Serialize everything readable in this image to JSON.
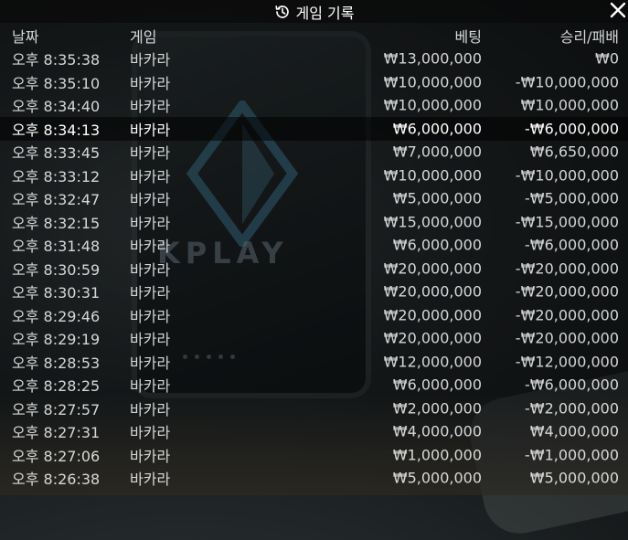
{
  "title": "게임 기록",
  "columns": {
    "date": "날짜",
    "game": "게임",
    "bet": "베팅",
    "result": "승리/패배"
  },
  "background_brand": "KPLAY",
  "highlight_row_index": 3,
  "rows": [
    {
      "date": "오후 8:35:38",
      "game": "바카라",
      "bet": "₩13,000,000",
      "result": "₩0"
    },
    {
      "date": "오후 8:35:10",
      "game": "바카라",
      "bet": "₩10,000,000",
      "result": "-₩10,000,000"
    },
    {
      "date": "오후 8:34:40",
      "game": "바카라",
      "bet": "₩10,000,000",
      "result": "₩10,000,000"
    },
    {
      "date": "오후 8:34:13",
      "game": "바카라",
      "bet": "₩6,000,000",
      "result": "-₩6,000,000"
    },
    {
      "date": "오후 8:33:45",
      "game": "바카라",
      "bet": "₩7,000,000",
      "result": "₩6,650,000"
    },
    {
      "date": "오후 8:33:12",
      "game": "바카라",
      "bet": "₩10,000,000",
      "result": "-₩10,000,000"
    },
    {
      "date": "오후 8:32:47",
      "game": "바카라",
      "bet": "₩5,000,000",
      "result": "-₩5,000,000"
    },
    {
      "date": "오후 8:32:15",
      "game": "바카라",
      "bet": "₩15,000,000",
      "result": "-₩15,000,000"
    },
    {
      "date": "오후 8:31:48",
      "game": "바카라",
      "bet": "₩6,000,000",
      "result": "-₩6,000,000"
    },
    {
      "date": "오후 8:30:59",
      "game": "바카라",
      "bet": "₩20,000,000",
      "result": "-₩20,000,000"
    },
    {
      "date": "오후 8:30:31",
      "game": "바카라",
      "bet": "₩20,000,000",
      "result": "-₩20,000,000"
    },
    {
      "date": "오후 8:29:46",
      "game": "바카라",
      "bet": "₩20,000,000",
      "result": "-₩20,000,000"
    },
    {
      "date": "오후 8:29:19",
      "game": "바카라",
      "bet": "₩20,000,000",
      "result": "-₩20,000,000"
    },
    {
      "date": "오후 8:28:53",
      "game": "바카라",
      "bet": "₩12,000,000",
      "result": "-₩12,000,000"
    },
    {
      "date": "오후 8:28:25",
      "game": "바카라",
      "bet": "₩6,000,000",
      "result": "-₩6,000,000"
    },
    {
      "date": "오후 8:27:57",
      "game": "바카라",
      "bet": "₩2,000,000",
      "result": "-₩2,000,000"
    },
    {
      "date": "오후 8:27:31",
      "game": "바카라",
      "bet": "₩4,000,000",
      "result": "₩4,000,000"
    },
    {
      "date": "오후 8:27:06",
      "game": "바카라",
      "bet": "₩1,000,000",
      "result": "-₩1,000,000"
    },
    {
      "date": "오후 8:26:38",
      "game": "바카라",
      "bet": "₩5,000,000",
      "result": "₩5,000,000"
    }
  ],
  "icons": {
    "title": "history-icon",
    "close": "close-icon"
  }
}
